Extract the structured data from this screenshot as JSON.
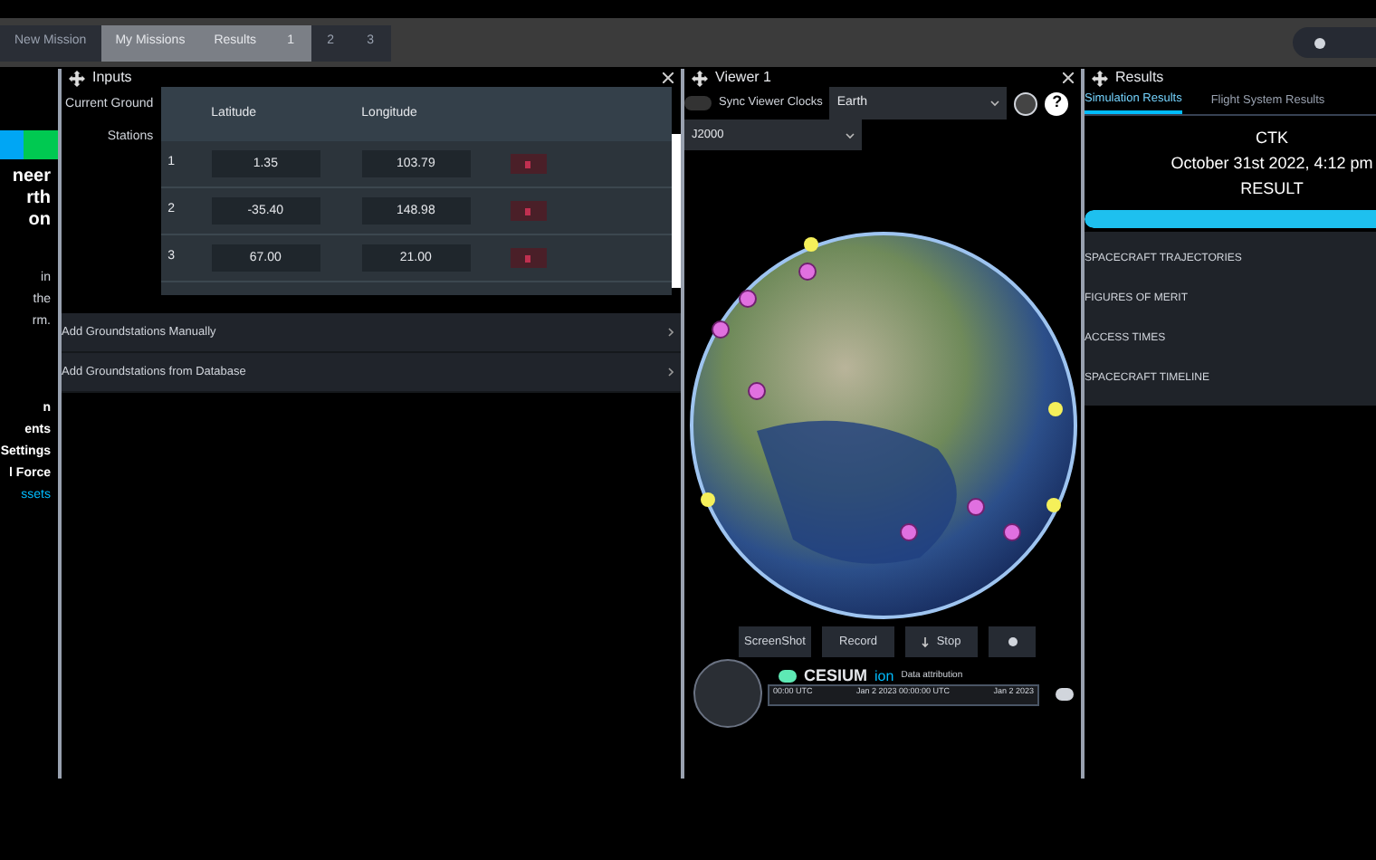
{
  "top_bar": {
    "tabs": [
      {
        "label": "New Mission",
        "selected": false
      },
      {
        "label": "My Missions",
        "selected": true
      },
      {
        "label": "Results",
        "selected": true
      },
      {
        "label": "1",
        "selected": true
      },
      {
        "label": "2",
        "selected": false
      },
      {
        "label": "3",
        "selected": false
      }
    ]
  },
  "left_panel": {
    "texts": [
      {
        "text": "neer",
        "kind": "heading"
      },
      {
        "text": "rth",
        "kind": "heading"
      },
      {
        "text": "on",
        "kind": "heading"
      },
      {
        "text": "in",
        "kind": "body"
      },
      {
        "text": "the",
        "kind": "body"
      },
      {
        "text": "rm.",
        "kind": "body"
      },
      {
        "text": "n",
        "kind": "menu"
      },
      {
        "text": "ents",
        "kind": "menu"
      },
      {
        "text": "Settings",
        "kind": "menu"
      },
      {
        "text": "l Force",
        "kind": "menu"
      },
      {
        "text": "ssets",
        "kind": "link"
      }
    ]
  },
  "inputs": {
    "title": "Inputs",
    "label": "Current Ground Stations",
    "columns": [
      "Latitude",
      "Longitude"
    ],
    "rows": [
      {
        "index": "1",
        "latitude": "1.35",
        "longitude": "103.79"
      },
      {
        "index": "2",
        "latitude": "-35.40",
        "longitude": "148.98"
      },
      {
        "index": "3",
        "latitude": "67.00",
        "longitude": "21.00"
      }
    ],
    "sections": [
      "Add Groundstations Manually",
      "Add Groundstations from Database"
    ]
  },
  "viewer": {
    "title": "Viewer 1",
    "sync_label": "Sync Viewer Clocks",
    "sync_on": false,
    "body": "Earth",
    "frame": "J2000",
    "buttons": [
      {
        "label": "ScreenShot",
        "kind": "text"
      },
      {
        "label": "Record",
        "kind": "text"
      },
      {
        "label": "Stop",
        "kind": "stop"
      },
      {
        "kind": "dot"
      }
    ],
    "help_label": "?",
    "logo": "CESIUM",
    "logo_suffix": "ion",
    "attribution": "Data attribution",
    "timeline": [
      "00:00 UTC",
      "Jan 2 2023 00:00:00 UTC",
      "Jan 2 2023"
    ]
  },
  "results": {
    "title": "Results",
    "tabs": [
      {
        "label": "Simulation Results",
        "selected": true
      },
      {
        "label": "Flight System Results",
        "selected": false
      }
    ],
    "name": "CTK",
    "date": "October 31st 2022, 4:12 pm",
    "heading": "RESULT",
    "level": 1,
    "items": [
      "SPACECRAFT TRAJECTORIES",
      "FIGURES OF MERIT",
      "ACCESS TIMES",
      "SPACECRAFT TIMELINE"
    ]
  }
}
